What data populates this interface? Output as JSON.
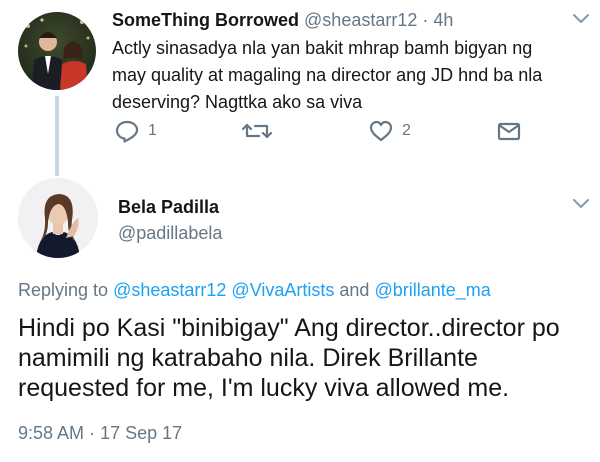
{
  "parent_tweet": {
    "display_name": "SomeThing Borrowed",
    "handle": "@sheastarr12",
    "separator": "·",
    "time": "4h",
    "text": "Actly sinasadya nla yan bakit mhrap bamh bigyan ng may quality at magaling na director ang JD hnd ba nla deserving? Nagttka ako sa viva",
    "actions": {
      "reply_icon": "reply-icon",
      "reply_count": "1",
      "retweet_icon": "retweet-icon",
      "like_icon": "heart-icon",
      "like_count": "2",
      "dm_icon": "envelope-icon"
    }
  },
  "focused_tweet": {
    "display_name": "Bela Padilla",
    "handle": "@padillabela",
    "replying_prefix": "Replying to",
    "replying_mention_1": "@sheastarr12",
    "replying_mention_2": "@VivaArtists",
    "replying_and": "and",
    "replying_mention_3": "@brillante_ma",
    "text": "Hindi po Kasi \"binibigay\" Ang director..director po namimili ng katrabaho nila. Direk Brillante requested for me, I'm lucky viva allowed me.",
    "time": "9:58 AM",
    "separator": "·",
    "date": "17 Sep 17"
  },
  "colors": {
    "text": "#14171a",
    "secondary": "#657786",
    "link": "#1da1f2",
    "thread_line": "#ccd6dd"
  }
}
